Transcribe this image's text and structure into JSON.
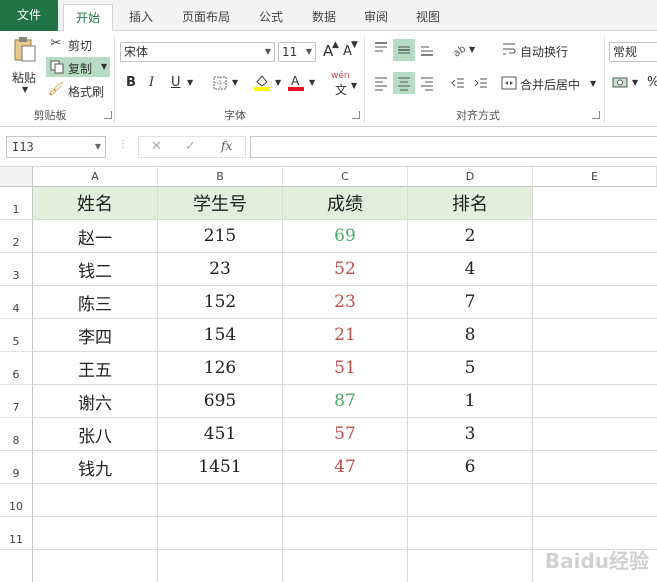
{
  "tabs": [
    "文件",
    "开始",
    "插入",
    "页面布局",
    "公式",
    "数据",
    "审阅",
    "视图"
  ],
  "ribbon": {
    "clipboard": {
      "paste": "粘贴",
      "cut": "剪切",
      "copy": "复制",
      "format_painter": "格式刷",
      "label": "剪贴板"
    },
    "font": {
      "name": "宋体",
      "size": "11",
      "label": "字体",
      "bold": "B",
      "italic": "I",
      "underline": "U",
      "grow": "A",
      "shrink": "A",
      "wen": "wén",
      "fill_color": "#ffff00",
      "font_color": "#e81123"
    },
    "alignment": {
      "wrap_text": "自动换行",
      "merge_center": "合并后居中",
      "label": "对齐方式"
    },
    "number": {
      "format": "常规"
    }
  },
  "formula_bar": {
    "name_box": "I13",
    "cancel": "✕",
    "enter": "✓",
    "fx": "fx",
    "formula": ""
  },
  "columns": [
    "A",
    "B",
    "C",
    "D",
    "E"
  ],
  "rows": [
    "1",
    "2",
    "3",
    "4",
    "5",
    "6",
    "7",
    "8",
    "9",
    "10",
    "11"
  ],
  "table": {
    "headers": [
      "姓名",
      "学生号",
      "成绩",
      "排名"
    ],
    "data": [
      [
        "赵一",
        "215",
        "69",
        "2"
      ],
      [
        "钱二",
        "23",
        "52",
        "4"
      ],
      [
        "陈三",
        "152",
        "23",
        "7"
      ],
      [
        "李四",
        "154",
        "21",
        "8"
      ],
      [
        "王五",
        "126",
        "51",
        "5"
      ],
      [
        "谢六",
        "695",
        "87",
        "1"
      ],
      [
        "张八",
        "451",
        "57",
        "3"
      ],
      [
        "钱九",
        "1451",
        "47",
        "6"
      ]
    ],
    "score_colors": {
      "pass": "#4ea96b",
      "fail": "#c0504d"
    }
  },
  "watermark": "Baidu经验"
}
